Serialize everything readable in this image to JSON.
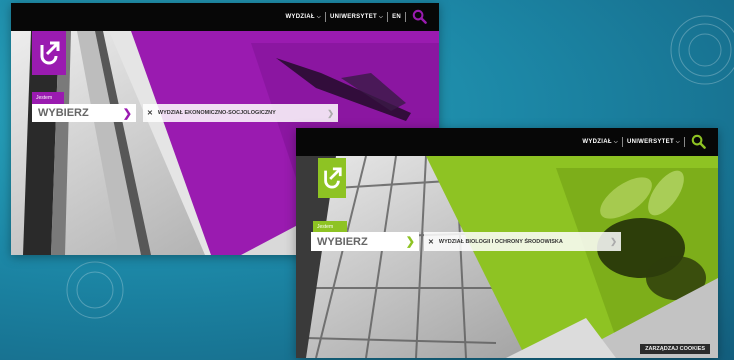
{
  "colors": {
    "purple_accent": "#9a1bb0",
    "green_accent": "#8ec323",
    "slide_background": "#1c87a6"
  },
  "screenshot_purple": {
    "nav": {
      "wydzial": "WYDZIAŁ",
      "uniwersytet": "UNIWERSYTET",
      "lang": "EN"
    },
    "logo_icon": "university-logo-icon",
    "jestem_label": "Jestem",
    "select_value": "WYBIERZ",
    "faculty_value": "WYDZIAŁ EKONOMICZNO-SOCJOLOGICZNY"
  },
  "screenshot_green": {
    "nav": {
      "wydzial": "WYDZIAŁ",
      "uniwersytet": "UNIWERSYTET"
    },
    "logo_icon": "university-logo-icon",
    "jestem_label": "Jestem",
    "select_value": "WYBIERZ",
    "faculty_value": "WYDZIAŁ BIOLOGII I OCHRONY ŚRODOWISKA",
    "cookies_button": "ZARZĄDZAJ COOKIES"
  }
}
